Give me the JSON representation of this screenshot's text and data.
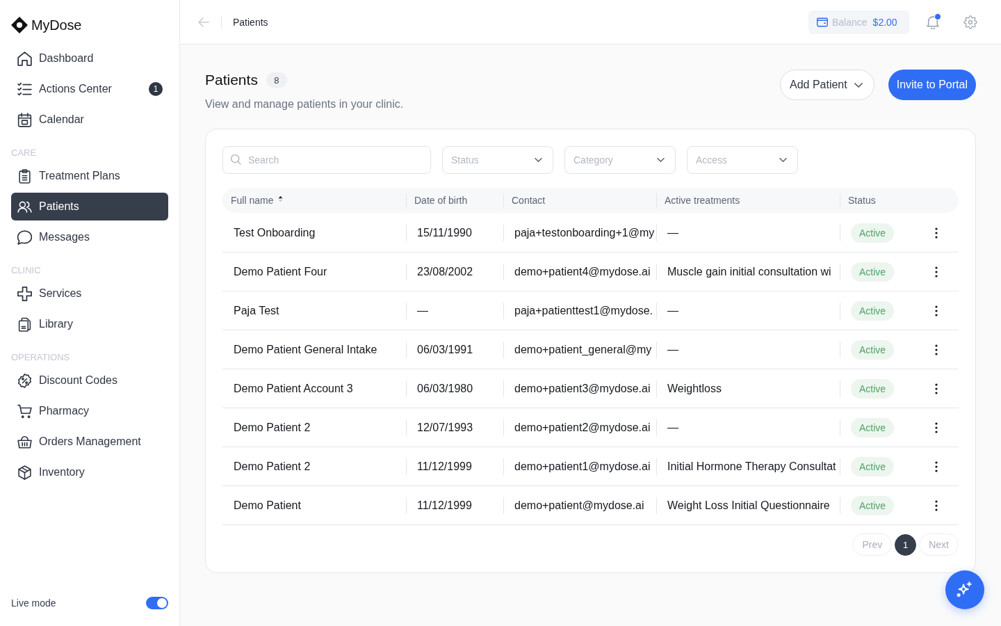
{
  "sidebar": {
    "brand": "MyDose",
    "groups": [
      {
        "items": [
          {
            "label": "Dashboard",
            "selected": false
          },
          {
            "label": "Actions Center",
            "selected": false,
            "badge": "1"
          },
          {
            "label": "Calendar",
            "selected": false
          }
        ]
      },
      {
        "heading": "CARE",
        "items": [
          {
            "label": "Treatment Plans",
            "selected": false
          },
          {
            "label": "Patients",
            "selected": true
          },
          {
            "label": "Messages",
            "selected": false
          }
        ]
      },
      {
        "heading": "CLINIC",
        "items": [
          {
            "label": "Services",
            "selected": false
          },
          {
            "label": "Library",
            "selected": false
          }
        ]
      },
      {
        "heading": "OPERATIONS",
        "items": [
          {
            "label": "Discount Codes",
            "selected": false
          },
          {
            "label": "Pharmacy",
            "selected": false
          },
          {
            "label": "Orders Management",
            "selected": false
          },
          {
            "label": "Inventory",
            "selected": false
          }
        ]
      }
    ],
    "live_mode": {
      "label": "Live mode",
      "on": true
    }
  },
  "topbar": {
    "breadcrumb": "Patients",
    "balance": {
      "label": "Balance",
      "amount": "$2.00"
    },
    "notifications": {
      "unread": true
    }
  },
  "header": {
    "title": "Patients",
    "count": "8",
    "subtitle": "View and manage patients in your clinic.",
    "buttons": [
      {
        "label": "Add Patient",
        "kind": "dropdown"
      },
      {
        "label": "Invite to Portal",
        "kind": "primary"
      }
    ]
  },
  "filters": {
    "search": {
      "placeholder": "Search"
    },
    "dropdowns": [
      {
        "placeholder": "Status"
      },
      {
        "placeholder": "Category"
      },
      {
        "placeholder": "Access"
      }
    ]
  },
  "table": {
    "columns": [
      {
        "label": "Full name",
        "sorted": true,
        "ascending": true
      },
      {
        "label": "Date of birth"
      },
      {
        "label": "Contact"
      },
      {
        "label": "Active treatments"
      },
      {
        "label": "Status"
      }
    ],
    "rows": [
      {
        "full_name": "Test Onboarding",
        "date_of_birth": "15/11/1990",
        "contact": "paja+testonboarding+1@my",
        "active_treatments": "—",
        "status": "Active"
      },
      {
        "full_name": "Demo Patient Four",
        "date_of_birth": "23/08/2002",
        "contact": "demo+patient4@mydose.ai",
        "active_treatments": "Muscle gain initial consultation wi",
        "status": "Active"
      },
      {
        "full_name": "Paja Test",
        "date_of_birth": "—",
        "contact": "paja+patienttest1@mydose.",
        "active_treatments": "—",
        "status": "Active"
      },
      {
        "full_name": "Demo Patient General Intake",
        "date_of_birth": "06/03/1991",
        "contact": "demo+patient_general@my",
        "active_treatments": "—",
        "status": "Active"
      },
      {
        "full_name": "Demo Patient Account 3",
        "date_of_birth": "06/03/1980",
        "contact": "demo+patient3@mydose.ai",
        "active_treatments": "Weightloss",
        "status": "Active"
      },
      {
        "full_name": "Demo Patient 2",
        "date_of_birth": "12/07/1993",
        "contact": "demo+patient2@mydose.ai",
        "active_treatments": "—",
        "status": "Active"
      },
      {
        "full_name": "Demo Patient 2",
        "date_of_birth": "11/12/1999",
        "contact": "demo+patient1@mydose.ai",
        "active_treatments": "Initial Hormone Therapy Consultat",
        "status": "Active"
      },
      {
        "full_name": "Demo Patient",
        "date_of_birth": "11/12/1999",
        "contact": "demo+patient@mydose.ai",
        "active_treatments": "Weight Loss Initial Questionnaire",
        "status": "Active"
      }
    ]
  },
  "pagination": {
    "prev": {
      "label": "Prev",
      "disabled": true
    },
    "pages": [
      {
        "label": "1",
        "selected": true
      }
    ],
    "next": {
      "label": "Next",
      "disabled": true
    }
  }
}
